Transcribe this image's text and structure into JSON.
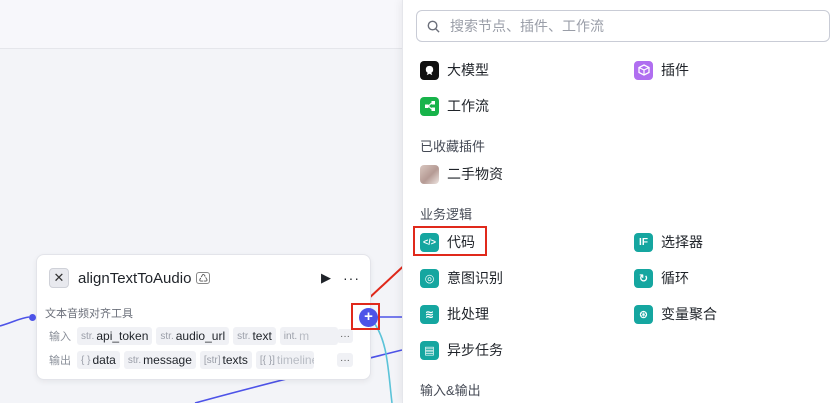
{
  "node": {
    "title": "alignTextToAudio",
    "description": "文本音频对齐工具",
    "input_label": "输入",
    "output_label": "输出",
    "inputs": [
      {
        "type": "str.",
        "name": "api_token"
      },
      {
        "type": "str.",
        "name": "audio_url"
      },
      {
        "type": "str.",
        "name": "text"
      },
      {
        "type": "int.",
        "name": "m"
      }
    ],
    "outputs": [
      {
        "type": "{ }",
        "name": "data"
      },
      {
        "type": "str.",
        "name": "message"
      },
      {
        "type": "[str]",
        "name": "texts"
      },
      {
        "type": "[{ }]",
        "name": "timeline"
      }
    ],
    "more_glyph": "···",
    "play_glyph": "▶",
    "tool_glyph": "✕",
    "badge_glyph": "♺",
    "ellipsis": "···"
  },
  "add_button": {
    "glyph": "+"
  },
  "panel": {
    "search": {
      "placeholder": "搜索节点、插件、工作流",
      "value": ""
    },
    "top_items": [
      {
        "label": "大模型",
        "icon": "llm-icon"
      },
      {
        "label": "插件",
        "icon": "plugin-icon"
      },
      {
        "label": "工作流",
        "icon": "workflow-icon"
      }
    ],
    "favorites_header": "已收藏插件",
    "favorites": [
      {
        "label": "二手物资",
        "icon": "avatar-icon"
      }
    ],
    "logic_header": "业务逻辑",
    "logic_items": [
      {
        "label": "代码",
        "icon": "code-icon",
        "glyph": "</>"
      },
      {
        "label": "选择器",
        "icon": "if-icon",
        "glyph": "IF"
      },
      {
        "label": "意图识别",
        "icon": "intent-icon",
        "glyph": "◎"
      },
      {
        "label": "循环",
        "icon": "loop-icon",
        "glyph": "↻"
      },
      {
        "label": "批处理",
        "icon": "batch-icon",
        "glyph": "≋"
      },
      {
        "label": "变量聚合",
        "icon": "aggregate-icon",
        "glyph": "⊛"
      },
      {
        "label": "异步任务",
        "icon": "async-icon",
        "glyph": "▤"
      }
    ],
    "io_header": "输入&输出"
  },
  "colors": {
    "accent": "#4d53e8",
    "teal": "#15a6a0",
    "highlight": "#e0291b"
  }
}
